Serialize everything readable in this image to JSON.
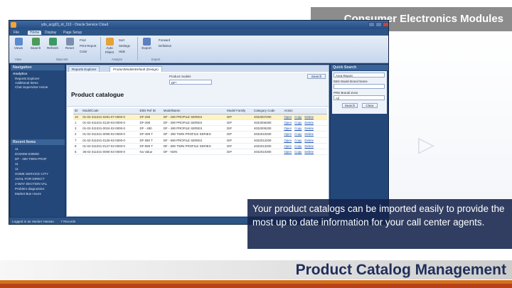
{
  "slide": {
    "title": "Consumer Electronics Modules",
    "caption": "Your product catalogs can be imported easily to provide the most up to date information for your call center agents.",
    "footer_title": "Product Catalog Management"
  },
  "app": {
    "window_title": "yds_acg(0)_nt_113 - Oracle Service Cloud",
    "menu": [
      "File",
      "Home",
      "Display",
      "Page Setup"
    ],
    "ribbon": {
      "buttons": [
        {
          "label": "Views",
          "icon": "views-icon"
        },
        {
          "label": "Search",
          "icon": "search-icon"
        },
        {
          "label": "Refresh",
          "icon": "refresh-icon"
        },
        {
          "label": "Reset",
          "icon": "reset-icon"
        },
        {
          "label": "Auto Filters",
          "icon": "filter-icon"
        },
        {
          "label": "Export",
          "icon": "export-icon"
        }
      ],
      "small": [
        "Find",
        "Print Report",
        "Color",
        "Sort",
        "Settings",
        "Hide",
        "Forward",
        "Definition"
      ],
      "groups": [
        "View",
        "Data Set",
        "Analyze",
        "Export"
      ]
    },
    "navigation": {
      "header": "Navigation",
      "section": "Analytics",
      "items": [
        "Reports Explorer",
        "Additional Items",
        "Chat Supervisor Home"
      ],
      "recent_header": "Recent Items",
      "recent_items": [
        "11",
        "DO2006-030800",
        "DF - 490 TWIN PROF",
        "11",
        "11",
        "HOME SERVICE CITY",
        "AVAIL FOR DIRECT",
        "2-WAY SECTION VAL",
        "Problem diagnostics",
        "Market Bus Hours"
      ]
    },
    "tabs": [
      "Reports Explorer",
      "ProductModelsDefault (Design)"
    ],
    "search": {
      "label": "Product models",
      "value": "DF*",
      "button": "Search"
    },
    "catalogue_title": "Product catalogue",
    "table": {
      "columns": [
        "ID",
        "ModelCode",
        "EBS Ref ID",
        "ModelName",
        "Model Family",
        "Category Code",
        "Action"
      ],
      "rows": [
        [
          "10",
          "01-02-311021-0291-07-0000-0",
          "DF-290",
          "DF - 290 PROFILE SERIES",
          "DIF",
          "4032007200"
        ],
        [
          "1",
          "01-02-311021-0120-03-0000-0",
          "DF-290",
          "DF - 290 PROFILE SERIES",
          "DIF",
          "4032006300"
        ],
        [
          "3",
          "01-02-311021-0024-02-0000-0",
          "DF - 490",
          "DF - 490 PROFILE SERIES",
          "DIF",
          "4032000200"
        ],
        [
          "4",
          "01-02-311021-0006-02-0000-0",
          "DF-490 T",
          "DF - 490 TWIN PROFILE SERIES",
          "DIF",
          "4032010200"
        ],
        [
          "7",
          "01-02-311021-0125-02-0000-0",
          "DF 590 T",
          "DF - 590 PROFILE SERIES",
          "DIF",
          "4032012200"
        ],
        [
          "8",
          "01-02-311021-0127-02-0000-0",
          "DF-590 T",
          "DF - 590 TWIN PROFILE SERIES",
          "DIF",
          "4032013200"
        ],
        [
          "5",
          "35-02-311021-0000-02-0000-0",
          "No Value",
          "DF - NON",
          "DIF",
          "4032010300"
        ]
      ],
      "actions": [
        "Open",
        "Copy",
        "Delete"
      ]
    },
    "quick_search": {
      "header": "Quick Search",
      "type_value": "Area Report",
      "field1_label": "EBS Model Brand Name",
      "field2_label": "PRD Brandi Zone",
      "field2_value": "All",
      "search_button": "Search",
      "clear_button": "Clear"
    },
    "status": {
      "user": "Logged in as Hacker Hassan",
      "records": "7 Records"
    }
  },
  "colors": {
    "title_bg": "#8c8c8c",
    "caption_bg": "#14234b",
    "footer_text": "#1f2f5a",
    "accent_orange": "#d3701c",
    "accent_red": "#b84218"
  }
}
